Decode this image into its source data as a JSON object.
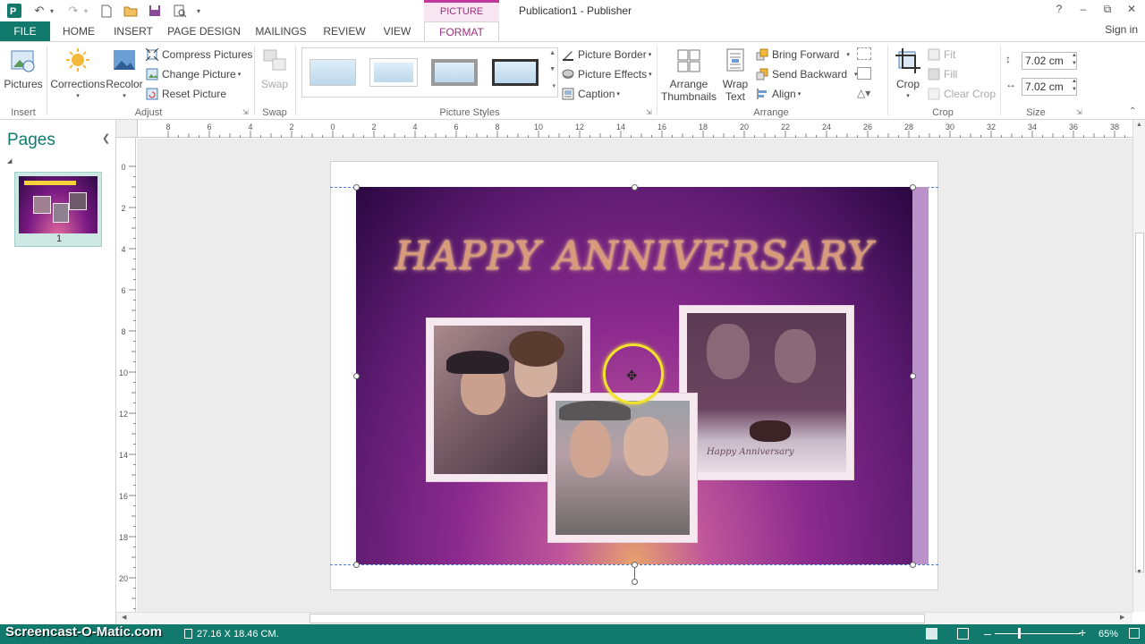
{
  "app": {
    "doc_title": "Publication1 - Publisher",
    "tools_label": "PICTURE TOOLS",
    "help": "?",
    "sign_in": "Sign in"
  },
  "tabs": [
    {
      "label": "FILE"
    },
    {
      "label": "HOME"
    },
    {
      "label": "INSERT"
    },
    {
      "label": "PAGE DESIGN"
    },
    {
      "label": "MAILINGS"
    },
    {
      "label": "REVIEW"
    },
    {
      "label": "VIEW"
    },
    {
      "label": "FORMAT"
    }
  ],
  "ribbon": {
    "insert": {
      "group": "Insert",
      "pictures": "Pictures"
    },
    "adjust": {
      "group": "Adjust",
      "corrections": "Corrections",
      "recolor": "Recolor",
      "compress": "Compress Pictures",
      "change": "Change Picture",
      "reset": "Reset Picture"
    },
    "swap": {
      "group": "Swap",
      "swap": "Swap"
    },
    "styles": {
      "group": "Picture Styles"
    },
    "picture": {
      "border": "Picture Border",
      "effects": "Picture Effects",
      "caption": "Caption"
    },
    "arrange": {
      "group": "Arrange",
      "thumbs_1": "Arrange",
      "thumbs_2": "Thumbnails",
      "wrap_1": "Wrap",
      "wrap_2": "Text",
      "forward": "Bring Forward",
      "backward": "Send Backward",
      "align": "Align"
    },
    "crop": {
      "group": "Crop",
      "crop": "Crop",
      "fit": "Fit",
      "fill": "Fill",
      "clear": "Clear Crop"
    },
    "size": {
      "group": "Size",
      "height": "7.02 cm",
      "width": "7.02 cm"
    }
  },
  "pages_pane": {
    "title": "Pages",
    "page_number": "1"
  },
  "ruler": {
    "h_ticks": [
      "8",
      "6",
      "4",
      "2",
      "0",
      "2",
      "4",
      "6",
      "8",
      "10",
      "12",
      "14",
      "16",
      "18",
      "20",
      "22",
      "24",
      "26",
      "28",
      "30",
      "32",
      "34",
      "36",
      "38"
    ],
    "v_ticks": [
      "0",
      "2",
      "4",
      "6",
      "8",
      "10",
      "12",
      "14",
      "16",
      "18",
      "20"
    ]
  },
  "publication": {
    "headline": "HAPPY ANNIVERSARY",
    "cake_text": "Happy Anniversary"
  },
  "status": {
    "watermark": "Screencast-O-Matic.com",
    "dimensions": "27.16 X 18.46 CM.",
    "zoom": "65%"
  },
  "colors": {
    "accent": "#127a6d",
    "tool_accent": "#9a2f80",
    "cursor_ring": "#f2e22b"
  }
}
